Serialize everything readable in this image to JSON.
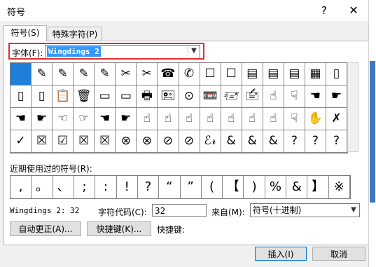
{
  "window": {
    "title": "符号",
    "help": "?",
    "close": "✕"
  },
  "tabs": [
    {
      "label": "符号(S)"
    },
    {
      "label": "特殊字符(P)"
    }
  ],
  "font": {
    "label": "字体(F):",
    "value": "Wingdings 2"
  },
  "grid": {
    "rows": [
      [
        "",
        "✎",
        "✎",
        "✎",
        "✎",
        "✂",
        "✂",
        "☎",
        "✆",
        "☐",
        "☐",
        "▤",
        "▤",
        "▤",
        "▦",
        "▯"
      ],
      [
        "▯",
        "▯",
        "📋",
        "🗑",
        "▭",
        "▭",
        "🖶",
        "🖭",
        "⊙",
        "📼",
        "🖅",
        "🖆",
        "☝",
        "☟",
        "☚",
        "☛"
      ],
      [
        "☚",
        "☛",
        "☜",
        "☞",
        "☚",
        "☛",
        "☝",
        "☝",
        "☝",
        "☝",
        "☝",
        "☝",
        "☝",
        "☟",
        "✋",
        "✗"
      ],
      [
        "✓",
        "☒",
        "☑",
        "☒",
        "☒",
        "⊗",
        "⊗",
        "⊘",
        "⊘",
        "ℰ𝓇",
        "&",
        "&",
        "&",
        "?",
        "?",
        "?"
      ]
    ],
    "selected_index": 0
  },
  "recent": {
    "label": "近期使用过的符号(R):",
    "symbols": [
      ",",
      "。",
      "、",
      ";",
      ":",
      "!",
      "?",
      "“",
      "”",
      "(",
      "【",
      ")",
      "%",
      "&",
      "】",
      "※"
    ]
  },
  "info": {
    "char_name": "Wingdings 2: 32",
    "code_label": "字符代码(C):",
    "code_value": "32",
    "from_label": "来自(M):",
    "from_value": "符号(十进制)"
  },
  "buttons": {
    "autocorrect": "自动更正(A)...",
    "shortcut_key": "快捷键(K)...",
    "shortcut_text": "快捷键:",
    "insert": "插入(I)",
    "cancel": "取消"
  },
  "colors": {
    "selection": "#1e7fd8",
    "highlight_box": "#e03030",
    "font_highlight": "#3399ff"
  }
}
